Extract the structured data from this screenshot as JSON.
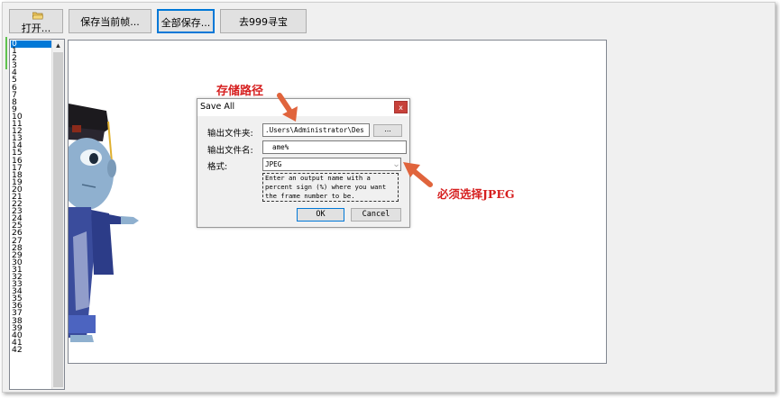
{
  "toolbar": {
    "open_label": "打开...",
    "save_current_label": "保存当前帧...",
    "save_all_label": "全部保存...",
    "goto_999_label": "去999寻宝"
  },
  "frame_list": {
    "items": [
      "0",
      "1",
      "2",
      "3",
      "4",
      "5",
      "6",
      "7",
      "8",
      "9",
      "10",
      "11",
      "12",
      "13",
      "14",
      "15",
      "16",
      "17",
      "18",
      "19",
      "20",
      "21",
      "22",
      "23",
      "24",
      "25",
      "26",
      "27",
      "28",
      "29",
      "30",
      "31",
      "32",
      "33",
      "34",
      "35",
      "36",
      "37",
      "38",
      "39",
      "40",
      "41",
      "42"
    ],
    "selected_index": 0
  },
  "dialog": {
    "title": "Save All",
    "close_label": "x",
    "folder_label": "输出文件夹:",
    "folder_value": ".Users\\Administrator\\Des",
    "browse_label": "...",
    "filename_label": "输出文件名:",
    "filename_value": "ame%",
    "format_label": "格式:",
    "format_value": "JPEG",
    "hint": "Enter an output name with a percent sign (%) where you want the frame number to be.",
    "ok_label": "OK",
    "cancel_label": "Cancel"
  },
  "annotations": {
    "path_note": "存储路径",
    "format_note": "必须选择JPEG",
    "color": "#d61f1f",
    "arrow_color": "#e0643c"
  },
  "icons": {
    "open": "folder-icon",
    "scroll_up": "chevron-up-icon",
    "dropdown": "chevron-down-icon"
  }
}
